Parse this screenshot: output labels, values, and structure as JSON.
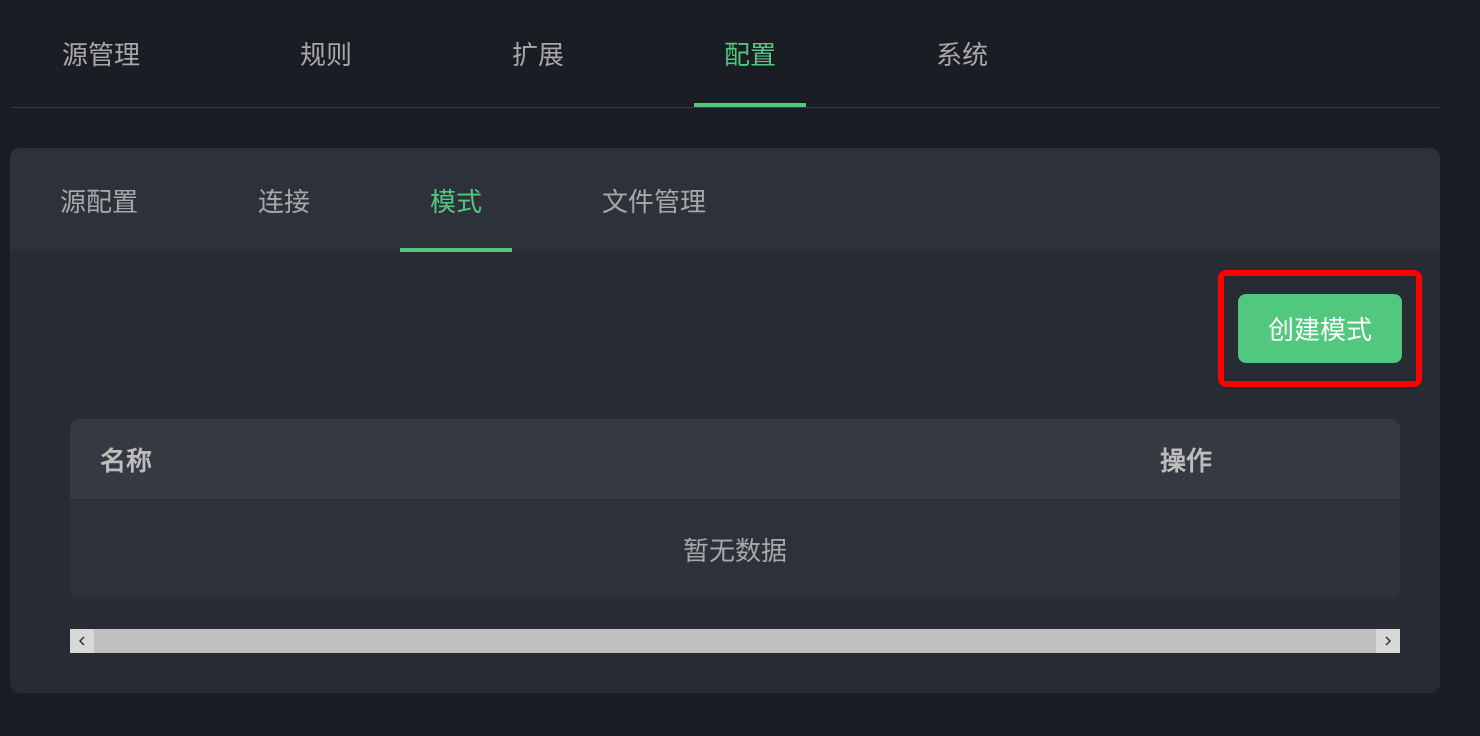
{
  "mainTabs": {
    "sourceManagement": "源管理",
    "rules": "规则",
    "extensions": "扩展",
    "configuration": "配置",
    "system": "系统"
  },
  "subTabs": {
    "sourceConfig": "源配置",
    "connection": "连接",
    "mode": "模式",
    "fileManagement": "文件管理"
  },
  "actions": {
    "createMode": "创建模式"
  },
  "table": {
    "columns": {
      "name": "名称",
      "actions": "操作"
    },
    "emptyText": "暂无数据"
  }
}
